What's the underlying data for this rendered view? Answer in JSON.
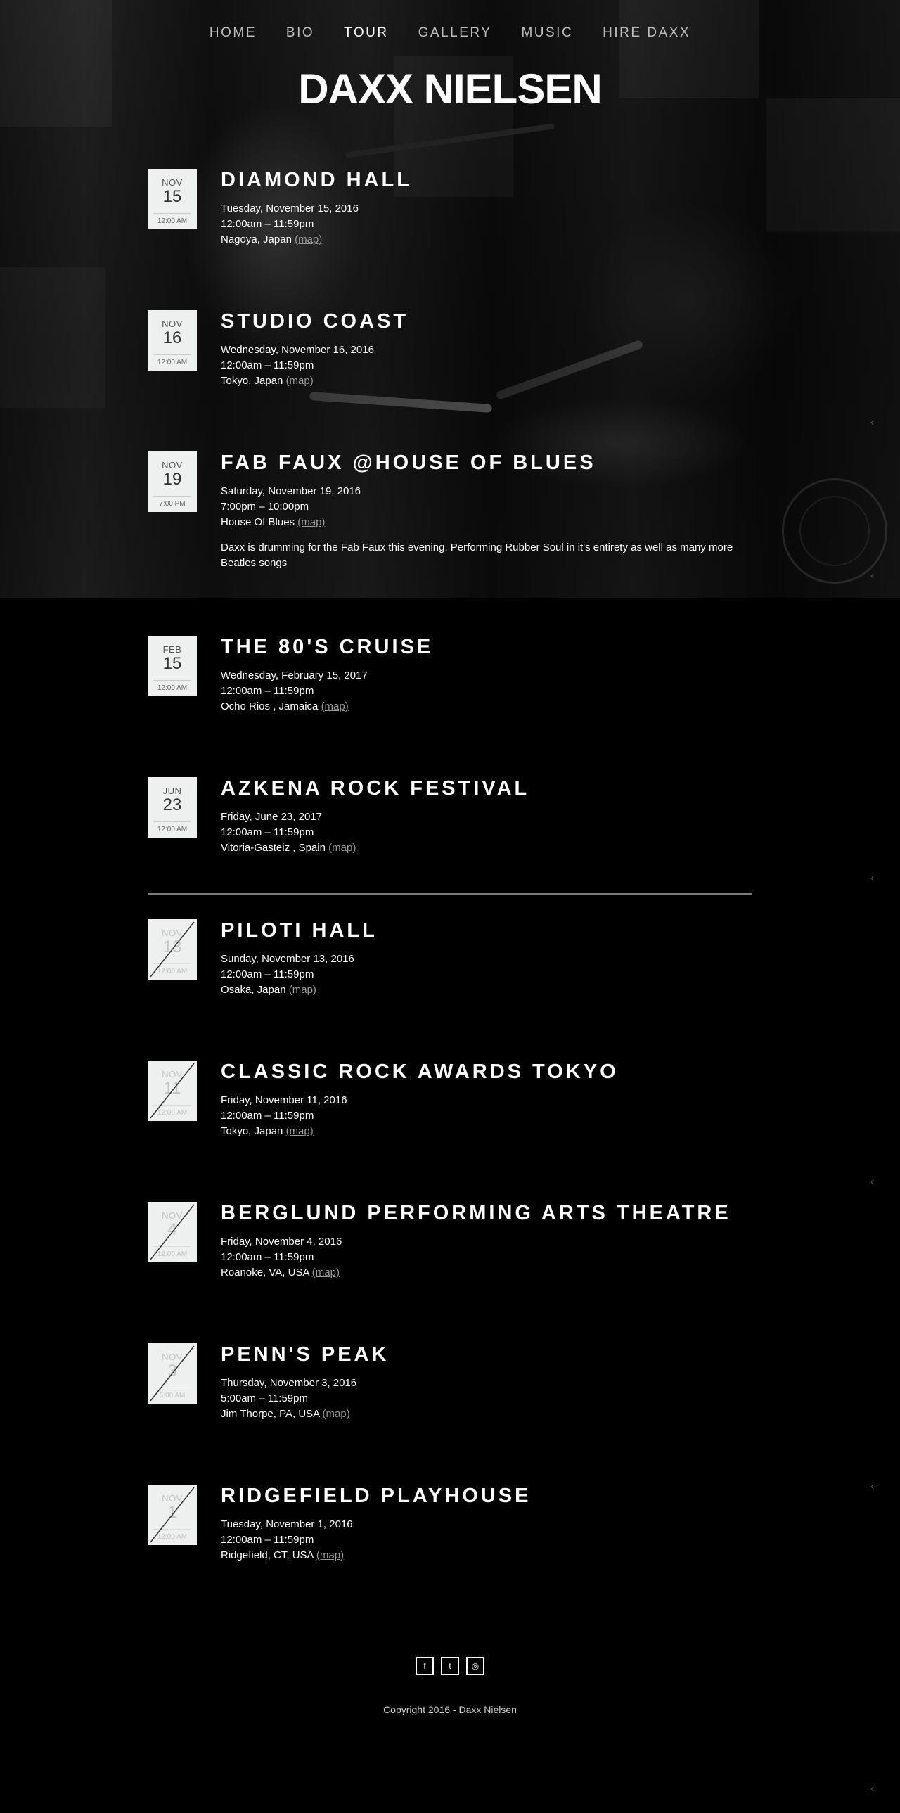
{
  "nav": {
    "items": [
      {
        "label": "HOME"
      },
      {
        "label": "BIO"
      },
      {
        "label": "TOUR"
      },
      {
        "label": "GALLERY"
      },
      {
        "label": "MUSIC"
      },
      {
        "label": "HIRE DAXX"
      }
    ],
    "active": "TOUR"
  },
  "site": {
    "title": "DAXX NIELSEN"
  },
  "upcoming": [
    {
      "month": "NOV",
      "day": "15",
      "time": "12:00 AM",
      "title": "DIAMOND HALL",
      "date": "Tuesday, November 15, 2016",
      "hours": "12:00am – 11:59pm",
      "location": "Nagoya, Japan",
      "map": "(map)"
    },
    {
      "month": "NOV",
      "day": "16",
      "time": "12:00 AM",
      "title": "STUDIO COAST",
      "date": "Wednesday, November 16, 2016",
      "hours": "12:00am – 11:59pm",
      "location": "Tokyo, Japan",
      "map": "(map)"
    },
    {
      "month": "NOV",
      "day": "19",
      "time": "7:00 PM",
      "title": "FAB FAUX @HOUSE OF BLUES",
      "date": "Saturday, November 19, 2016",
      "hours": "7:00pm – 10:00pm",
      "location": "House Of Blues",
      "map": "(map)",
      "description": "Daxx is drumming for the Fab Faux this evening. Performing Rubber Soul in it's entirety as well as many more Beatles songs"
    },
    {
      "month": "FEB",
      "day": "15",
      "time": "12:00 AM",
      "title": "THE 80'S CRUISE",
      "date": "Wednesday, February 15, 2017",
      "hours": "12:00am – 11:59pm",
      "location": "Ocho Rios , Jamaica",
      "map": "(map)"
    },
    {
      "month": "JUN",
      "day": "23",
      "time": "12:00 AM",
      "title": "AZKENA ROCK FESTIVAL",
      "date": "Friday, June 23, 2017",
      "hours": "12:00am – 11:59pm",
      "location": "Vitoria-Gasteiz , Spain",
      "map": "(map)"
    }
  ],
  "past": [
    {
      "month": "NOV",
      "day": "13",
      "time": "12:00 AM",
      "title": "PILOTI HALL",
      "date": "Sunday, November 13, 2016",
      "hours": "12:00am – 11:59pm",
      "location": "Osaka, Japan",
      "map": "(map)"
    },
    {
      "month": "NOV",
      "day": "11",
      "time": "12:00 AM",
      "title": "CLASSIC ROCK AWARDS TOKYO",
      "date": "Friday, November 11, 2016",
      "hours": "12:00am – 11:59pm",
      "location": "Tokyo, Japan",
      "map": "(map)"
    },
    {
      "month": "NOV",
      "day": "4",
      "time": "12:00 AM",
      "title": "BERGLUND PERFORMING ARTS THEATRE",
      "date": "Friday, November 4, 2016",
      "hours": "12:00am – 11:59pm",
      "location": "Roanoke, VA, USA",
      "map": "(map)"
    },
    {
      "month": "NOV",
      "day": "3",
      "time": "5:00 AM",
      "title": "PENN'S PEAK",
      "date": "Thursday, November 3, 2016",
      "hours": "5:00am – 11:59pm",
      "location": "Jim Thorpe, PA, USA",
      "map": "(map)"
    },
    {
      "month": "NOV",
      "day": "1",
      "time": "12:00 AM",
      "title": "RIDGEFIELD PLAYHOUSE",
      "date": "Tuesday, November 1, 2016",
      "hours": "12:00am – 11:59pm",
      "location": "Ridgefield, CT, USA",
      "map": "(map)"
    }
  ],
  "footer": {
    "social": [
      {
        "icon": "facebook-icon",
        "glyph": "f"
      },
      {
        "icon": "twitter-icon",
        "glyph": "t"
      },
      {
        "icon": "instagram-icon",
        "glyph": "◎"
      }
    ],
    "copyright": "Copyright 2016 - Daxx Nielsen"
  },
  "colors": {
    "background": "#000000",
    "text": "#ffffff",
    "muted": "#9a9a9a",
    "date_box": "#eef0ef"
  }
}
